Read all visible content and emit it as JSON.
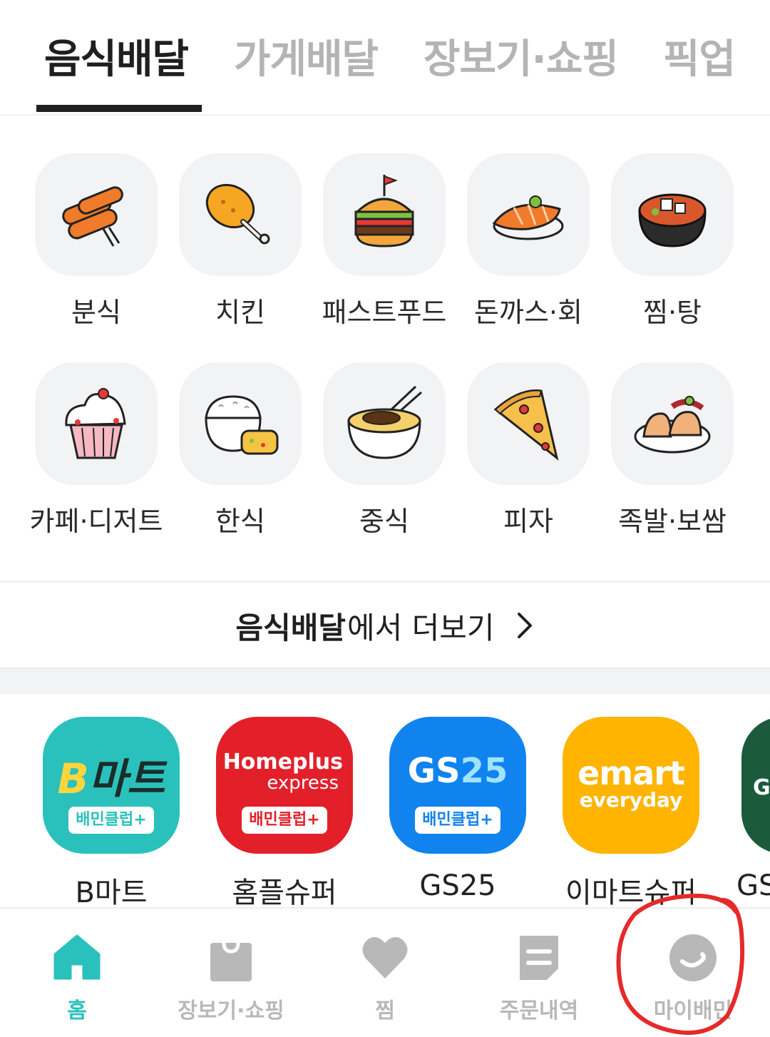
{
  "tabs": [
    {
      "label": "음식배달"
    },
    {
      "label": "가게배달"
    },
    {
      "label": "장보기·쇼핑"
    },
    {
      "label": "픽업"
    }
  ],
  "categories": [
    {
      "label": "분식",
      "icon": "tteokbokki-icon"
    },
    {
      "label": "치킨",
      "icon": "chicken-leg-icon"
    },
    {
      "label": "패스트푸드",
      "icon": "burger-icon"
    },
    {
      "label": "돈까스·회",
      "icon": "sushi-icon"
    },
    {
      "label": "찜·탕",
      "icon": "stew-pot-icon"
    },
    {
      "label": "카페·디저트",
      "icon": "cupcake-icon"
    },
    {
      "label": "한식",
      "icon": "rice-bowl-icon"
    },
    {
      "label": "중식",
      "icon": "jajangmyeon-icon"
    },
    {
      "label": "피자",
      "icon": "pizza-slice-icon"
    },
    {
      "label": "족발·보쌈",
      "icon": "jokbal-icon"
    }
  ],
  "more": {
    "bold": "음식배달",
    "rest": "에서 더보기"
  },
  "stores": [
    {
      "label": "B마트",
      "logo_text": "마트",
      "logo_letter": "B",
      "badge": "배민클럽+",
      "color": "#2ac1bc"
    },
    {
      "label": "홈플슈퍼",
      "logo_text": "Homeplus",
      "logo_sub": "express",
      "badge": "배민클럽+",
      "color": "#e3202a"
    },
    {
      "label": "GS25",
      "logo_text": "GS",
      "logo_num": "25",
      "badge": "배민클럽+",
      "color": "#1183ee"
    },
    {
      "label": "이마트슈퍼",
      "logo_text": "emart",
      "logo_sub": "everyday",
      "color": "#ffb400"
    },
    {
      "label": "GS",
      "logo_text": "G",
      "color": "#1c5a3c"
    }
  ],
  "bottom_nav": [
    {
      "label": "홈",
      "icon": "home-icon",
      "active": true
    },
    {
      "label": "장보기·쇼핑",
      "icon": "shopping-bag-icon"
    },
    {
      "label": "찜",
      "icon": "heart-icon"
    },
    {
      "label": "주문내역",
      "icon": "receipt-icon"
    },
    {
      "label": "마이배민",
      "icon": "smile-face-icon"
    }
  ],
  "colors": {
    "accent": "#2ac1bc",
    "inactive": "#b8b8b8",
    "annotation": "#e52a2a"
  }
}
